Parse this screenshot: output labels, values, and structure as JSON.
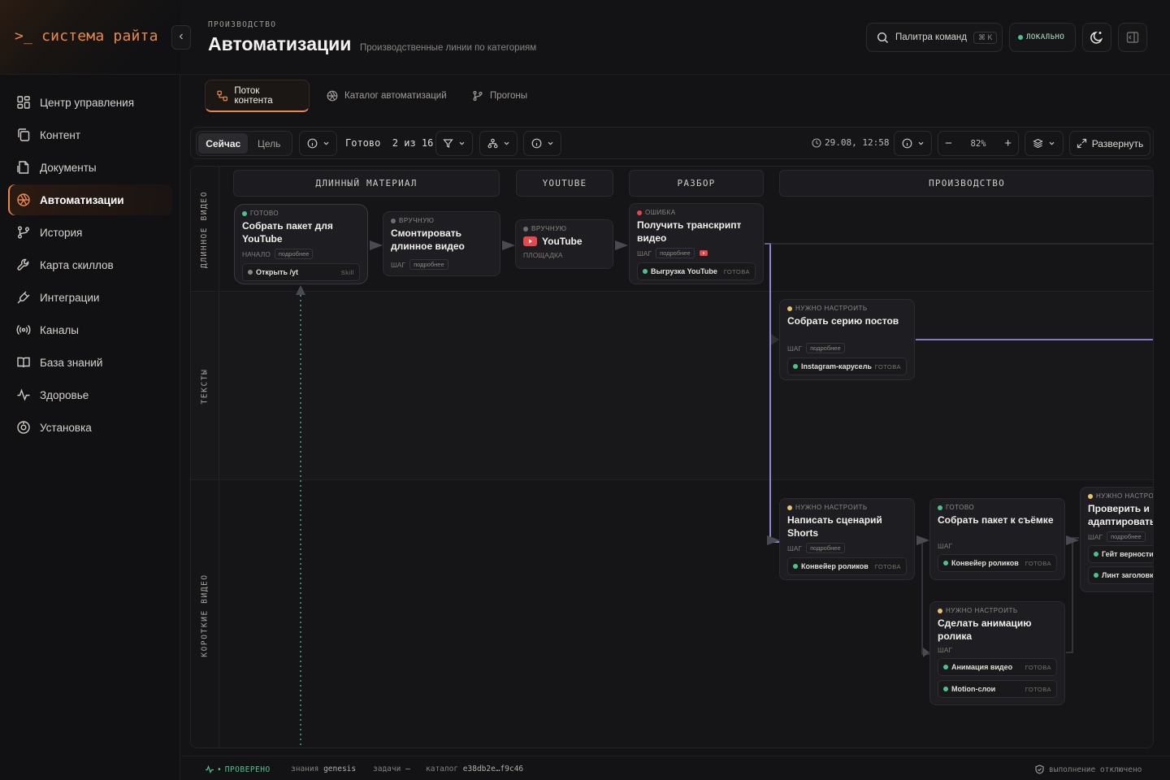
{
  "brand": {
    "prompt": ">_",
    "name": "система райта"
  },
  "sidebar": {
    "items": [
      {
        "label": "Центр управления",
        "icon": "dashboard-icon"
      },
      {
        "label": "Контент",
        "icon": "copy-icon"
      },
      {
        "label": "Документы",
        "icon": "document-icon"
      },
      {
        "label": "Автоматизации",
        "icon": "aperture-icon",
        "active": true
      },
      {
        "label": "История",
        "icon": "branch-icon"
      },
      {
        "label": "Карта скиллов",
        "icon": "wrench-icon"
      },
      {
        "label": "Интеграции",
        "icon": "plug-icon"
      },
      {
        "label": "Каналы",
        "icon": "broadcast-icon"
      },
      {
        "label": "База знаний",
        "icon": "book-icon"
      },
      {
        "label": "Здоровье",
        "icon": "pulse-icon"
      },
      {
        "label": "Установка",
        "icon": "setup-icon"
      }
    ]
  },
  "header": {
    "eyebrow": "ПРОИЗВОДСТВО",
    "title": "Автоматизации",
    "subtitle": "Производственные линии по категориям",
    "palette_label": "Палитра команд",
    "palette_shortcut": "⌘ K",
    "env_badge": "ЛОКАЛЬНО"
  },
  "tabs": [
    {
      "label": "Поток контента",
      "icon": "flow-icon",
      "active": true
    },
    {
      "label": "Каталог автоматизаций",
      "icon": "aperture-icon"
    },
    {
      "label": "Прогоны",
      "icon": "branch-icon"
    }
  ],
  "toolbar": {
    "mode_now": "Сейчас",
    "mode_goal": "Цель",
    "ready_text": "Готово  2 из 16",
    "timestamp": "29.08, 12:58",
    "zoom": "82%",
    "expand_label": "Развернуть"
  },
  "lanes": [
    "ДЛИННОЕ ВИДЕО",
    "ТЕКСТЫ",
    "КОРОТКИЕ ВИДЕО"
  ],
  "columns": [
    "ДЛИННЫЙ МАТЕРИАЛ",
    "YOUTUBE",
    "РАЗБОР",
    "ПРОИЗВОДСТВО"
  ],
  "colors": {
    "accent": "#e8884a",
    "ready": "#4cc38a",
    "manual": "#6e6e76",
    "error": "#e5484d",
    "setup": "#e9c46a",
    "edge": "#8b86d9"
  },
  "cards": {
    "pack_youtube": {
      "status": "ГОТОВО",
      "title1": "Собрать пакет для",
      "title2": "YouTube",
      "meta": "НАЧАЛО",
      "chip": "подробнее",
      "sub": "Открыть /yt",
      "sub_tag": "Skill"
    },
    "edit_long": {
      "status": "ВРУЧНУЮ",
      "title1": "Смонтировать",
      "title2": "длинное видео",
      "meta": "ШАГ",
      "chip": "подробнее"
    },
    "youtube": {
      "status": "ВРУЧНУЮ",
      "title": "YouTube",
      "meta": "ПЛОЩАДКА"
    },
    "transcript": {
      "status": "ОШИБКА",
      "title1": "Получить транскрипт",
      "title2": "видео",
      "meta": "ШАГ",
      "chip": "подробнее",
      "sub": "Выгрузка YouTube",
      "sub_tag": "ГОТОВА"
    },
    "posts": {
      "status": "НУЖНО НАСТРОИТЬ",
      "title": "Собрать серию постов",
      "meta": "ШАГ",
      "chip": "подробнее",
      "sub": "Instagram-карусель",
      "sub_tag": "ГОТОВА"
    },
    "shorts_script": {
      "status": "НУЖНО НАСТРОИТЬ",
      "title1": "Написать сценарий",
      "title2": "Shorts",
      "meta": "ШАГ",
      "chip": "подробнее",
      "sub": "Конвейер роликов",
      "sub_tag": "ГОТОВА"
    },
    "shoot_pack": {
      "status": "ГОТОВО",
      "title": "Собрать пакет к съёмке",
      "meta": "ШАГ",
      "sub": "Конвейер роликов",
      "sub_tag": "ГОТОВА"
    },
    "animation": {
      "status": "НУЖНО НАСТРОИТЬ",
      "title1": "Сделать анимацию",
      "title2": "ролика",
      "meta": "ШАГ",
      "sub1": "Анимация видео",
      "sub1_tag": "ГОТОВА",
      "sub2": "Motion-слои",
      "sub2_tag": "ГОТОВА"
    },
    "verify": {
      "status": "НУЖНО НАСТРОИТЬ",
      "title1": "Проверить и",
      "title2": "адаптировать",
      "meta": "ШАГ",
      "chip": "подробнее",
      "sub1": "Гейт верности",
      "sub2": "Линт заголовков"
    }
  },
  "statusbar": {
    "health": "ПРОВЕРЕНО",
    "knowledge_label": "знания",
    "knowledge_value": "genesis",
    "tasks_label": "задачи",
    "tasks_value": "—",
    "catalog_label": "каталог",
    "catalog_value": "e38db2e…f9c46",
    "execution": "выполнение отключено"
  }
}
